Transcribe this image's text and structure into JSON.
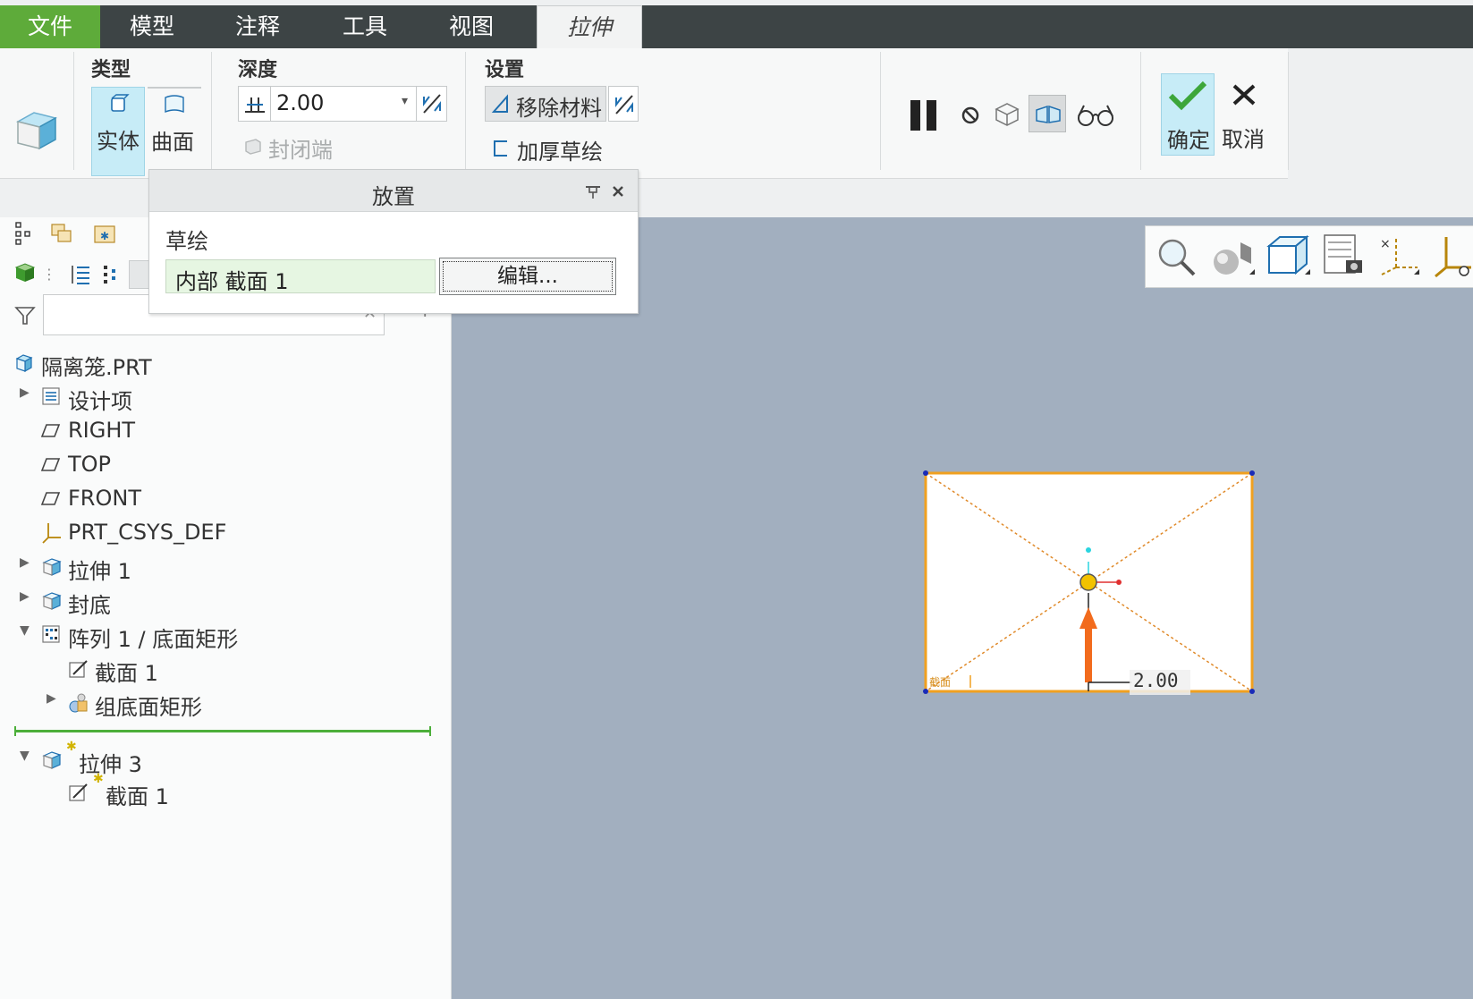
{
  "menu": {
    "tabs": [
      {
        "label": "文件"
      },
      {
        "label": "模型"
      },
      {
        "label": "注释"
      },
      {
        "label": "工具"
      },
      {
        "label": "视图"
      },
      {
        "label": "拉伸"
      }
    ]
  },
  "ribbon": {
    "type_group": {
      "title": "类型",
      "solid": "实体",
      "surface": "曲面"
    },
    "depth_group": {
      "title": "深度",
      "value": "2.00",
      "cap_ends": "封闭端"
    },
    "settings_group": {
      "title": "设置",
      "remove_material": "移除材料",
      "thicken_sketch": "加厚草绘"
    },
    "actions": {
      "ok": "确定",
      "cancel": "取消"
    }
  },
  "placement_panel": {
    "title": "放置",
    "section_label": "草绘",
    "sketch_value": "内部 截面 1",
    "edit_button": "编辑..."
  },
  "model_tree": {
    "filter_placeholder": "",
    "items": [
      {
        "label": "隔离笼.PRT"
      },
      {
        "label": "设计项"
      },
      {
        "label": "RIGHT"
      },
      {
        "label": "TOP"
      },
      {
        "label": "FRONT"
      },
      {
        "label": "PRT_CSYS_DEF"
      },
      {
        "label": "拉伸 1"
      },
      {
        "label": "封底"
      },
      {
        "label": "阵列 1 / 底面矩形"
      },
      {
        "label": "截面 1"
      },
      {
        "label": "组底面矩形"
      },
      {
        "label": "拉伸 3"
      },
      {
        "label": "截面 1"
      }
    ]
  },
  "viewport": {
    "dimension": "2.00",
    "section_tag": "截面"
  },
  "colors": {
    "file_tab": "#5eab3a",
    "menu_bar": "#3d4445",
    "viewport_bg": "#a2afbf",
    "sketch_outline": "#f0a020",
    "direction_arrow": "#f26b1d",
    "selected_button": "#c7ecf7",
    "tree_insert_line": "#4caf3a"
  }
}
